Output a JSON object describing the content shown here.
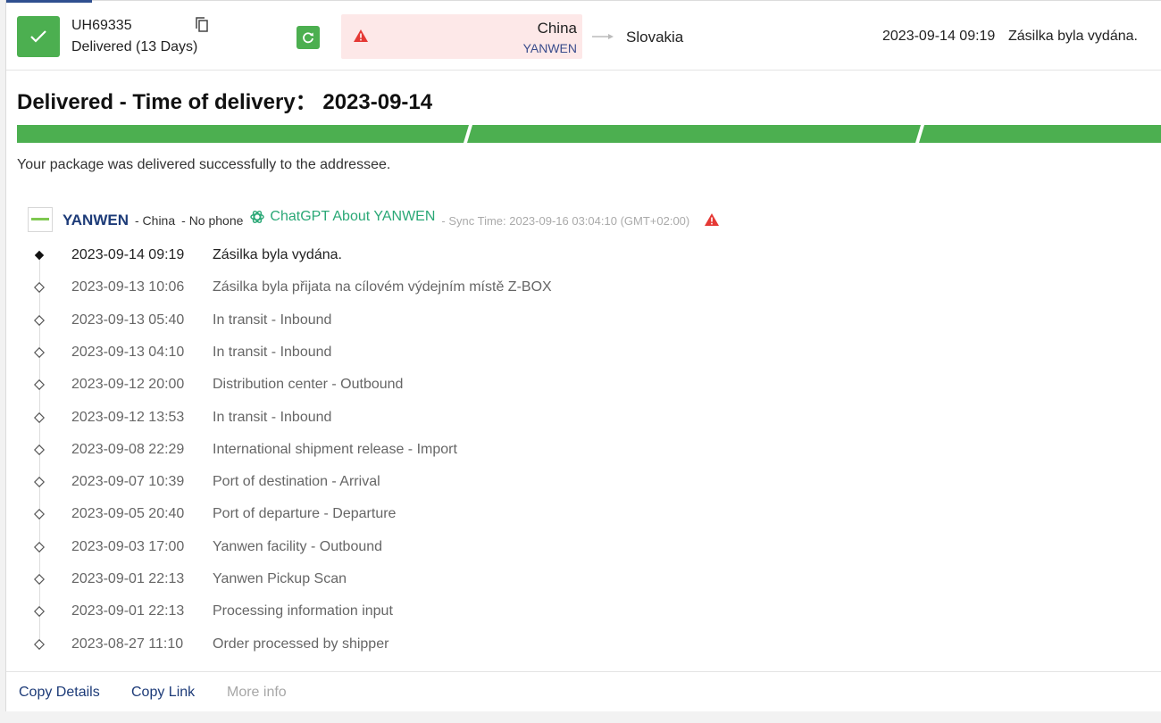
{
  "header": {
    "tracking_number": "UH69335",
    "delivery_status": "Delivered (13 Days)",
    "origin_country": "China",
    "origin_carrier": "YANWEN",
    "destination_country": "Slovakia",
    "latest_time": "2023-09-14 09:19",
    "latest_description": "Zásilka byla vydána.",
    "icons": {
      "status": "check-icon",
      "copy": "copy-icon",
      "refresh": "refresh-icon",
      "warning": "warning-icon",
      "route": "arrow-right-icon"
    }
  },
  "summary": {
    "title": "Delivered - Time of delivery： 2023-09-14",
    "message": "Your package was delivered successfully to the addressee.",
    "progress_percent": 100
  },
  "carrier": {
    "name": "YANWEN",
    "origin": "- China",
    "phone": "- No phone",
    "chatgpt_label": "ChatGPT About YANWEN",
    "sync_time": "- Sync Time: 2023-09-16 03:04:10 (GMT+02:00)"
  },
  "events": [
    {
      "time": "2023-09-14 09:19",
      "description": "Zásilka byla vydána."
    },
    {
      "time": "2023-09-13 10:06",
      "description": "Zásilka byla přijata na cílovém výdejním místě Z-BOX"
    },
    {
      "time": "2023-09-13 05:40",
      "description": "In transit - Inbound"
    },
    {
      "time": "2023-09-13 04:10",
      "description": "In transit - Inbound"
    },
    {
      "time": "2023-09-12 20:00",
      "description": "Distribution center - Outbound"
    },
    {
      "time": "2023-09-12 13:53",
      "description": "In transit - Inbound"
    },
    {
      "time": "2023-09-08 22:29",
      "description": "International shipment release - Import"
    },
    {
      "time": "2023-09-07 10:39",
      "description": "Port of destination - Arrival"
    },
    {
      "time": "2023-09-05 20:40",
      "description": "Port of departure - Departure"
    },
    {
      "time": "2023-09-03 17:00",
      "description": "Yanwen facility - Outbound"
    },
    {
      "time": "2023-09-01 22:13",
      "description": "Yanwen Pickup Scan"
    },
    {
      "time": "2023-09-01 22:13",
      "description": "Processing information input"
    },
    {
      "time": "2023-08-27 11:10",
      "description": "Order processed by shipper"
    }
  ],
  "footer": {
    "copy_details": "Copy Details",
    "copy_link": "Copy Link",
    "more_info": "More info"
  },
  "colors": {
    "success": "#4caf50",
    "warning": "#e53935",
    "link": "#1d3b78",
    "chatgpt": "#2aa876"
  }
}
